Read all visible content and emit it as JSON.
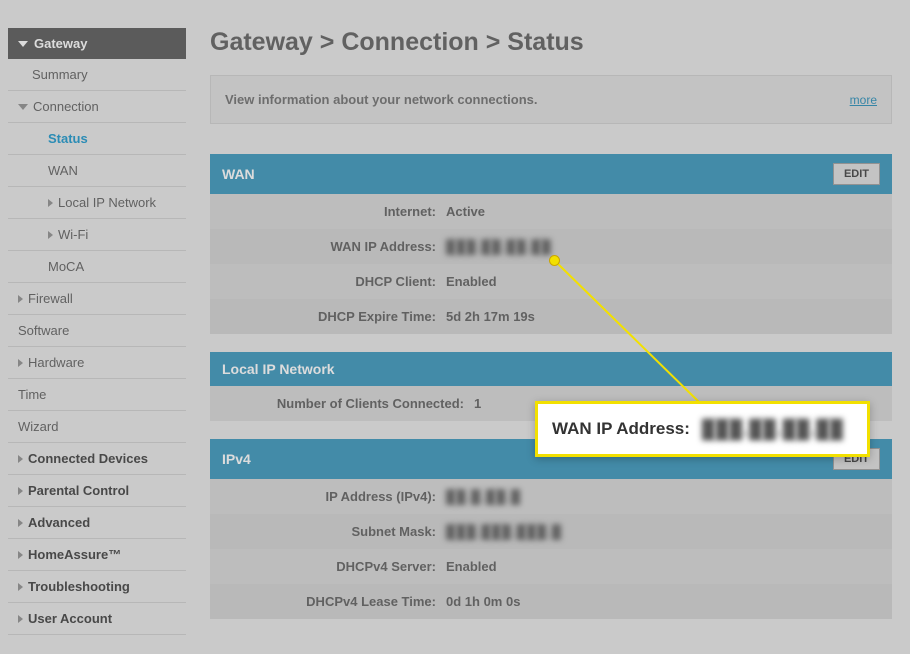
{
  "sidebar": {
    "header": "Gateway",
    "items": [
      {
        "label": "Summary",
        "indent": 1
      },
      {
        "label": "Connection",
        "indent": 0,
        "expandable": true,
        "open": true
      },
      {
        "label": "Status",
        "indent": 2,
        "active": true
      },
      {
        "label": "WAN",
        "indent": 2
      },
      {
        "label": "Local IP Network",
        "indent": 2,
        "expandable": true
      },
      {
        "label": "Wi-Fi",
        "indent": 2,
        "expandable": true
      },
      {
        "label": "MoCA",
        "indent": 2
      },
      {
        "label": "Firewall",
        "indent": 0,
        "expandable": true
      },
      {
        "label": "Software",
        "indent": 0
      },
      {
        "label": "Hardware",
        "indent": 0,
        "expandable": true
      },
      {
        "label": "Time",
        "indent": 0
      },
      {
        "label": "Wizard",
        "indent": 0
      }
    ],
    "top_items": [
      {
        "label": "Connected Devices"
      },
      {
        "label": "Parental Control"
      },
      {
        "label": "Advanced"
      },
      {
        "label": "HomeAssure™"
      },
      {
        "label": "Troubleshooting"
      },
      {
        "label": "User Account"
      }
    ]
  },
  "breadcrumb": "Gateway > Connection > Status",
  "infobar": {
    "text": "View information about your network connections.",
    "more": "more"
  },
  "wan": {
    "title": "WAN",
    "edit": "EDIT",
    "rows": [
      {
        "label": "Internet:",
        "value": "Active"
      },
      {
        "label": "WAN IP Address:",
        "value": "███.██.██.██",
        "blur": true
      },
      {
        "label": "DHCP Client:",
        "value": "Enabled"
      },
      {
        "label": "DHCP Expire Time:",
        "value": "5d 2h 17m 19s"
      }
    ]
  },
  "lan": {
    "title": "Local IP Network",
    "rows": [
      {
        "label": "Number of Clients Connected:",
        "value": "1"
      }
    ]
  },
  "ipv4": {
    "title": "IPv4",
    "edit": "EDIT",
    "rows": [
      {
        "label": "IP Address (IPv4):",
        "value": "██.█.██.█",
        "blur": true
      },
      {
        "label": "Subnet Mask:",
        "value": "███.███.███.█",
        "blur": true
      },
      {
        "label": "DHCPv4 Server:",
        "value": "Enabled"
      },
      {
        "label": "DHCPv4 Lease Time:",
        "value": "0d 1h 0m 0s"
      }
    ]
  },
  "callout": {
    "label": "WAN IP Address:",
    "value": "███.██.██.██"
  }
}
